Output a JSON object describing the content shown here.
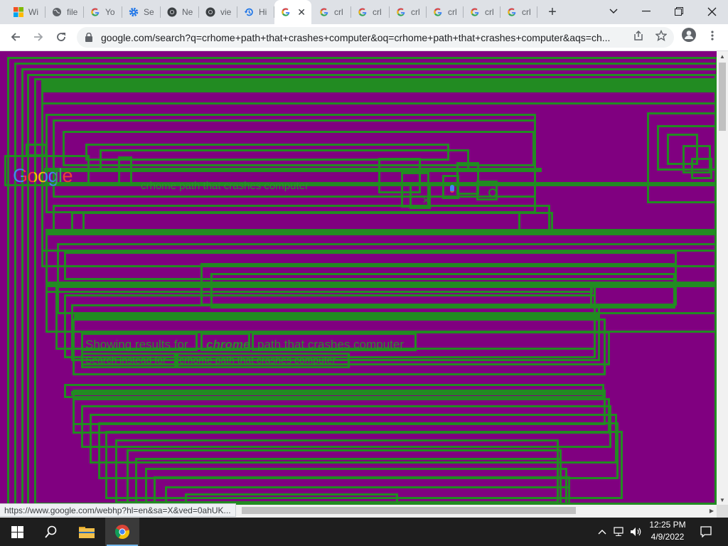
{
  "tabs": [
    {
      "title": "Wi",
      "icon": "windows-icon"
    },
    {
      "title": "file",
      "icon": "globe-icon"
    },
    {
      "title": "Yo",
      "icon": "google-g-icon"
    },
    {
      "title": "Se",
      "icon": "settings-gear-icon"
    },
    {
      "title": "Ne",
      "icon": "chrome-icon"
    },
    {
      "title": "vie",
      "icon": "chrome-icon"
    },
    {
      "title": "Hi",
      "icon": "history-icon"
    },
    {
      "title": "",
      "icon": "google-g-icon",
      "active": true
    },
    {
      "title": "crl",
      "icon": "google-g-icon"
    },
    {
      "title": "crl",
      "icon": "google-g-icon"
    },
    {
      "title": "crl",
      "icon": "google-g-icon"
    },
    {
      "title": "crl",
      "icon": "google-g-icon"
    },
    {
      "title": "crl",
      "icon": "google-g-icon"
    },
    {
      "title": "crl",
      "icon": "google-g-icon"
    }
  ],
  "toolbar": {
    "url": "google.com/search?q=crhome+path+that+crashes+computer&oq=crhome+path+that+crashes+computer&aqs=ch..."
  },
  "page": {
    "logo_text": "Google",
    "search_value": "crhome path that crashes computer",
    "showing_results_for": "Showing results for",
    "corrected_term": "chrome",
    "corrected_rest": "path that crashes computer",
    "search_instead_for": "Search instead for",
    "original_query": "crhome path that crashes computer"
  },
  "status_url": "https://www.google.com/webhp?hl=en&sa=X&ved=0ahUK...",
  "taskbar": {
    "time": "12:25 PM",
    "date": "4/9/2022"
  },
  "colors": {
    "page_background": "#800080",
    "outline": "#228b22"
  }
}
